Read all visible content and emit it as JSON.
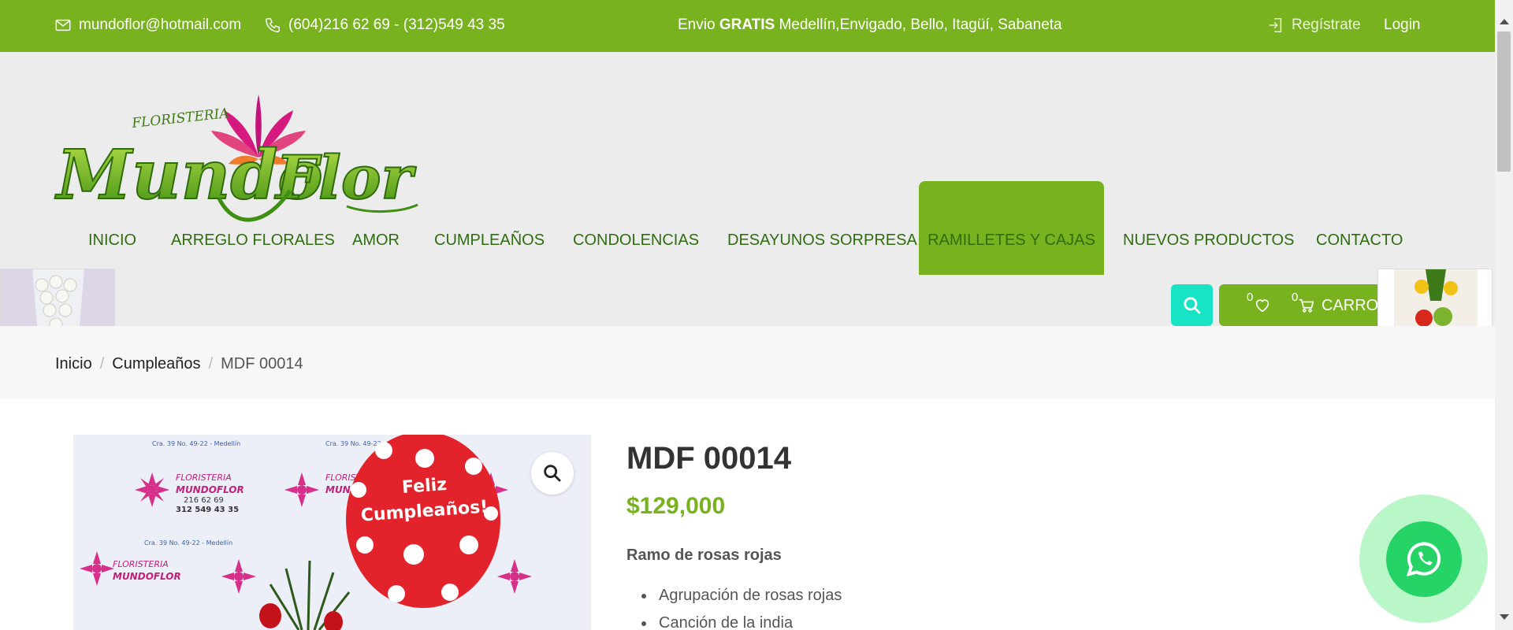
{
  "topbar": {
    "email": "mundoflor@hotmail.com",
    "phone": "(604)216 62 69 - (312)549 43 35",
    "shipping_prefix": "Envio",
    "shipping_bold": "GRATIS",
    "shipping_areas": "Medellín,Envigado, Bello, Itagüí, Sabaneta",
    "register": "Regístrate",
    "login": "Login"
  },
  "logo": {
    "small_text": "FLORISTERIA",
    "word1": "Mundo",
    "word2": "Flor"
  },
  "nav": {
    "items": [
      {
        "label": "INICIO"
      },
      {
        "label": "ARREGLO FLORALES"
      },
      {
        "label": "AMOR"
      },
      {
        "label": "CUMPLEAÑOS"
      },
      {
        "label": "CONDOLENCIAS"
      },
      {
        "label": "DESAYUNOS SORPRESA"
      },
      {
        "label": "RAMILLETES Y CAJAS"
      },
      {
        "label": "NUEVOS PRODUCTOS"
      },
      {
        "label": "CONTACTO"
      }
    ],
    "active_index": 6
  },
  "cart": {
    "wishlist_count": "0",
    "cart_count": "0",
    "label": "CARRO"
  },
  "breadcrumb": {
    "home": "Inicio",
    "category": "Cumpleaños",
    "current": "MDF 00014"
  },
  "product": {
    "title": "MDF 00014",
    "price": "$129,000",
    "subtitle": "Ramo de rosas rojas",
    "features": [
      "Agrupación de rosas rojas",
      "Canción de la india"
    ],
    "balloon_text_1": "Feliz",
    "balloon_text_2": "Cumpleaños!",
    "backdrop_brand": "FLORISTERIA",
    "backdrop_name": "MUNDOFLOR",
    "backdrop_phone1": "216 62 69",
    "backdrop_phone2": "312 549 43 35",
    "backdrop_address": "Cra. 39 No. 49-22 - Medellín"
  },
  "colors": {
    "brand_green": "#78b21e",
    "nav_text": "#2f6d10",
    "search_teal": "#19e3c6",
    "whatsapp": "#25d366"
  },
  "icons": [
    "mail-icon",
    "phone-icon",
    "login-icon",
    "search-icon",
    "heart-icon",
    "cart-icon",
    "zoom-icon",
    "whatsapp-icon"
  ]
}
